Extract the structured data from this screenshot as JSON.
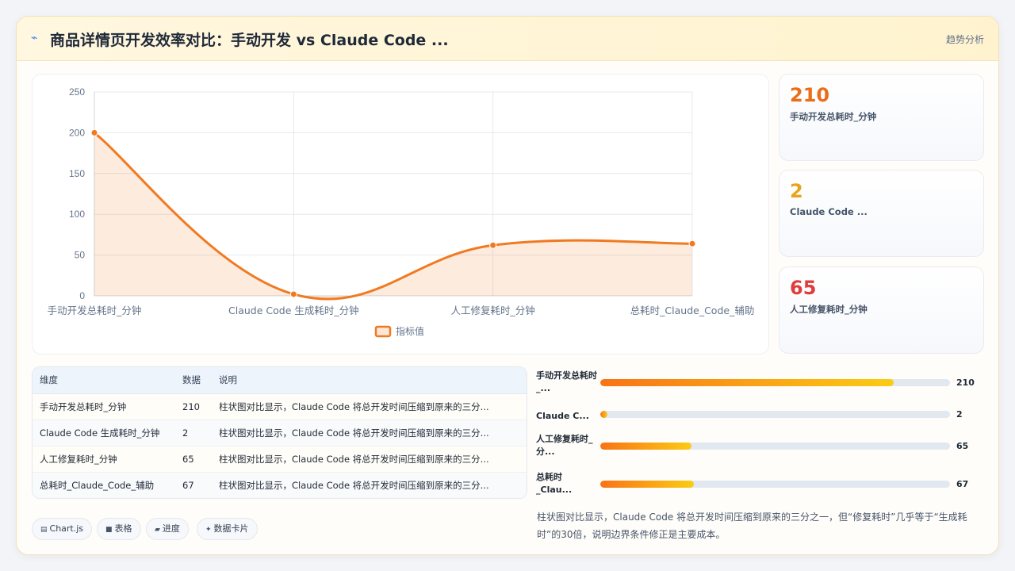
{
  "header": {
    "icon": "trend-line-icon",
    "title": "商品详情页开发效率对比：手动开发 vs Claude Code ...",
    "action_label": "趋势分析"
  },
  "chart_data": {
    "type": "area",
    "categories": [
      "手动开发总耗时_分钟",
      "Claude Code 生成耗时_分钟",
      "人工修复耗时_分钟",
      "总耗时_Claude_Code_辅助"
    ],
    "series": [
      {
        "name": "指标值",
        "values": [
          200,
          2,
          62,
          64
        ],
        "color": "#f07a22"
      }
    ],
    "ylim": [
      0,
      250
    ],
    "yticks": [
      0,
      50,
      100,
      150,
      200,
      250
    ],
    "grid": true,
    "legend": "bottom",
    "smooth": true
  },
  "stat_cards": [
    {
      "value": "210",
      "label": "手动开发总耗时_分钟",
      "color": "#ea6d1a"
    },
    {
      "value": "2",
      "label": "Claude Code ...",
      "color": "#eaa21a"
    },
    {
      "value": "65",
      "label": "人工修复耗时_分钟",
      "color": "#e03c3c"
    }
  ],
  "table": {
    "headers": [
      "维度",
      "数据",
      "说明"
    ],
    "rows": [
      [
        "手动开发总耗时_分钟",
        "210",
        "柱状图对比显示，Claude Code 将总开发时间压缩到原来的三分..."
      ],
      [
        "Claude Code 生成耗时_分钟",
        "2",
        "柱状图对比显示，Claude Code 将总开发时间压缩到原来的三分..."
      ],
      [
        "人工修复耗时_分钟",
        "65",
        "柱状图对比显示，Claude Code 将总开发时间压缩到原来的三分..."
      ],
      [
        "总耗时_Claude_Code_辅助",
        "67",
        "柱状图对比显示，Claude Code 将总开发时间压缩到原来的三分..."
      ]
    ]
  },
  "tags": [
    {
      "icon": "chart-icon",
      "glyph": "▤",
      "label": "Chart.js"
    },
    {
      "icon": "table-icon",
      "glyph": "■",
      "label": "表格"
    },
    {
      "icon": "progress-icon",
      "glyph": "▰",
      "label": "进度"
    },
    {
      "icon": "sparkle-icon",
      "glyph": "✦",
      "label": "数据卡片"
    }
  ],
  "progress": {
    "max": 250,
    "items": [
      {
        "label": "手动开发总耗时_...",
        "value": 210,
        "display": "210"
      },
      {
        "label": "Claude C...",
        "value": 5,
        "display": "2"
      },
      {
        "label": "人工修复耗时_分...",
        "value": 65,
        "display": "65"
      },
      {
        "label": "总耗时_Clau...",
        "value": 67,
        "display": "67"
      }
    ]
  },
  "insight": "柱状图对比显示，Claude Code 将总开发时间压缩到原来的三分之一，但“修复耗时”几乎等于“生成耗时”的30倍，说明边界条件修正是主要成本。"
}
